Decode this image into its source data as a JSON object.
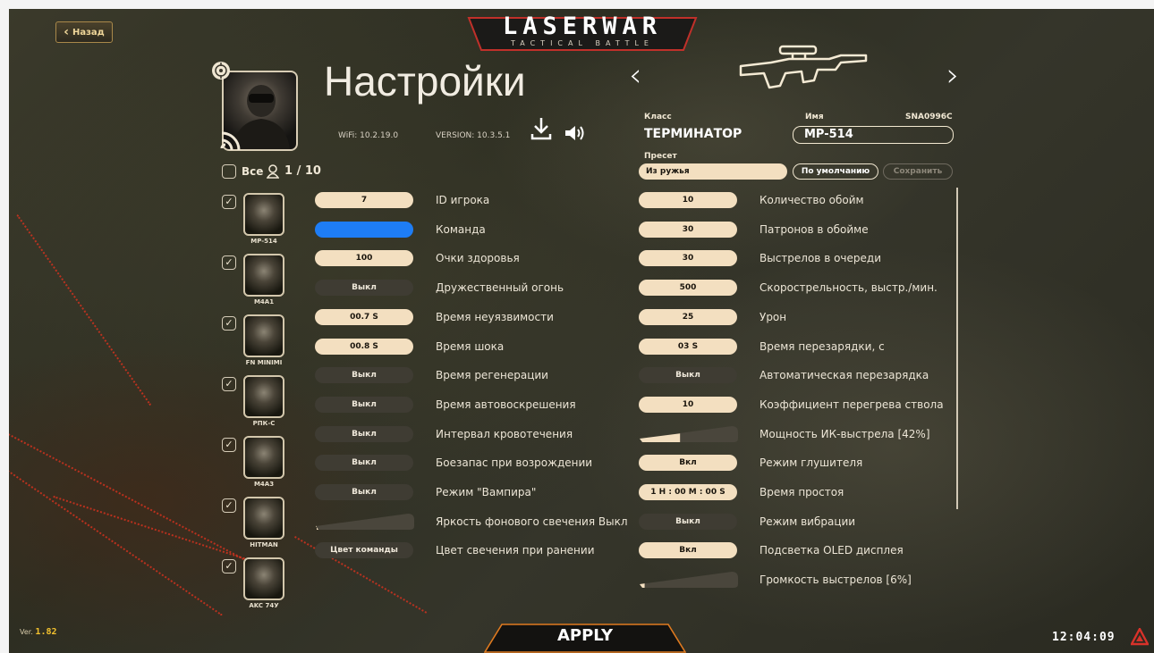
{
  "header": {
    "back_label": "Назад",
    "logo_main": "LASERWAR",
    "logo_sub": "TACTICAL BATTLE",
    "title": "Настройки",
    "wifi": "WiFi: 10.2.19.0",
    "version": "VERSION: 10.3.5.1"
  },
  "weapon": {
    "class_label": "Класс",
    "class_value": "ТЕРМИНАТОР",
    "name_label": "Имя",
    "device_id": "SNA0996C",
    "name_value": "MP-514",
    "preset_label": "Пресет",
    "preset_value": "Из ружья",
    "default_button": "По умолчанию",
    "save_button": "Сохранить"
  },
  "selection": {
    "all_label": "Все",
    "count": "1 / 10"
  },
  "players": [
    {
      "name": "MP-514",
      "checked": true
    },
    {
      "name": "M4A1",
      "checked": true
    },
    {
      "name": "FN MINIMI",
      "checked": true
    },
    {
      "name": "РПК-С",
      "checked": true
    },
    {
      "name": "M4A3",
      "checked": true
    },
    {
      "name": "HITMAN",
      "checked": true
    },
    {
      "name": "AKC 74У",
      "checked": true
    }
  ],
  "player_settings": [
    {
      "value": "7",
      "label": "ID игрока",
      "style": "on"
    },
    {
      "value": "",
      "label": "Команда",
      "style": "blue",
      "color": "#1e7df5"
    },
    {
      "value": "100",
      "label": "Очки здоровья",
      "style": "on"
    },
    {
      "value": "Выкл",
      "label": "Дружественный огонь",
      "style": "off"
    },
    {
      "value": "00.7 S",
      "label": "Время неуязвимости",
      "style": "on"
    },
    {
      "value": "00.8 S",
      "label": "Время шока",
      "style": "on"
    },
    {
      "value": "Выкл",
      "label": "Время регенерации",
      "style": "off"
    },
    {
      "value": "Выкл",
      "label": "Время автовоскрешения",
      "style": "off"
    },
    {
      "value": "Выкл",
      "label": "Интервал кровотечения",
      "style": "off"
    },
    {
      "value": "Выкл",
      "label": "Боезапас при возрождении",
      "style": "off"
    },
    {
      "value": "Выкл",
      "label": "Режим \"Вампира\"",
      "style": "off"
    },
    {
      "value": "",
      "label": "Яркость фонового свечения Выкл",
      "style": "slider",
      "level": 0
    },
    {
      "value": "Цвет команды",
      "label": "Цвет свечения при ранении",
      "style": "off"
    }
  ],
  "weapon_settings": [
    {
      "value": "10",
      "label": "Количество обойм",
      "style": "on"
    },
    {
      "value": "30",
      "label": "Патронов в обойме",
      "style": "on"
    },
    {
      "value": "30",
      "label": "Выстрелов в очереди",
      "style": "on"
    },
    {
      "value": "500",
      "label": "Скорострельность, выстр./мин.",
      "style": "on"
    },
    {
      "value": "25",
      "label": "Урон",
      "style": "on"
    },
    {
      "value": "03 S",
      "label": "Время перезарядки, с",
      "style": "on"
    },
    {
      "value": "Выкл",
      "label": "Автоматическая перезарядка",
      "style": "off"
    },
    {
      "value": "10",
      "label": "Коэффициент перегрева ствола",
      "style": "on"
    },
    {
      "value": "",
      "label": "Мощность ИК-выстрела [42%]",
      "style": "slider",
      "level": 0.42
    },
    {
      "value": "Вкл",
      "label": "Режим глушителя",
      "style": "on"
    },
    {
      "value": "1 H : 00 M : 00 S",
      "label": "Время простоя",
      "style": "on"
    },
    {
      "value": "Выкл",
      "label": "Режим вибрации",
      "style": "off"
    },
    {
      "value": "Вкл",
      "label": "Подсветка OLED дисплея",
      "style": "on"
    },
    {
      "value": "",
      "label": "Громкость выстрелов [6%]",
      "style": "slider",
      "level": 0.06
    }
  ],
  "footer": {
    "ver_label": "Ver.",
    "ver_value": "1.82",
    "apply": "APPLY",
    "clock": "12:04:09"
  },
  "icons": [
    "back-chevron-icon",
    "target-icon",
    "signal-icon",
    "download-icon",
    "speaker-icon",
    "chevron-left-icon",
    "chevron-right-icon",
    "rifle-icon",
    "user-icon",
    "checkmark-icon",
    "laserwar-mark-icon"
  ],
  "colors": {
    "accent": "#f3dfc0",
    "team": "#1e7df5",
    "apply_border": "#e07a1f",
    "ver_digits": "#f2c12e"
  }
}
